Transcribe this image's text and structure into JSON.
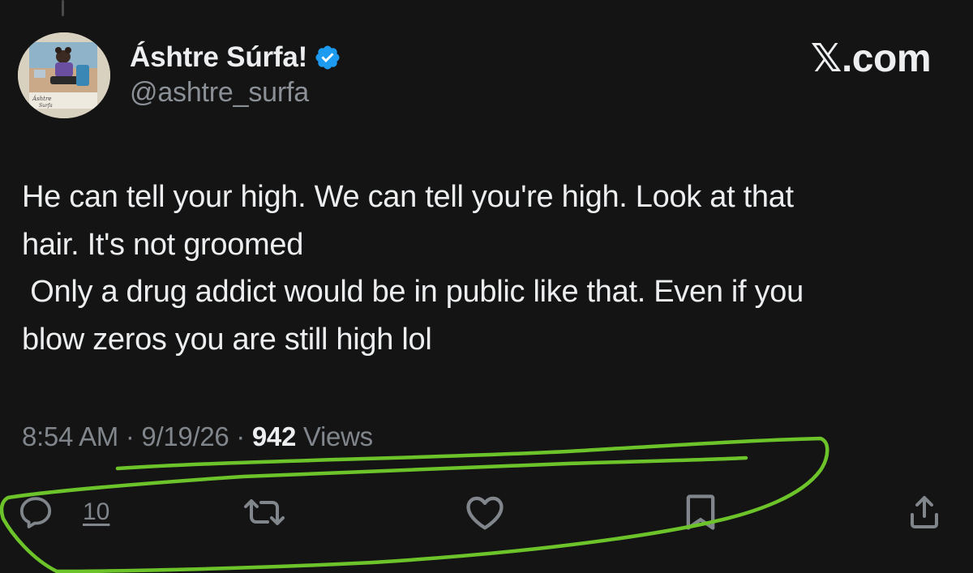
{
  "brand": {
    "label": "𝕏.com"
  },
  "author": {
    "display_name": "Áshtre Súrfa!",
    "handle": "@ashtre_surfa",
    "verified": true
  },
  "avatar": {
    "caption_line1": "Áshtre",
    "caption_line2": "Surfa"
  },
  "tweet": {
    "text": "He can tell your high. We can tell you're high. Look at that\nhair. It's not groomed\n Only a drug addict would be in public like that. Even if you\nblow zeros you are still high lol"
  },
  "meta": {
    "time": "8:54 AM",
    "sep1": " · ",
    "date": "9/19/26",
    "sep2": " · ",
    "views_count": "942",
    "views_label": " Views"
  },
  "actions": {
    "reply_count": "10",
    "icons": [
      "reply-icon",
      "retweet-icon",
      "like-icon",
      "bookmark-icon",
      "share-icon"
    ]
  },
  "colors": {
    "background": "#141414",
    "text": "#eceef0",
    "muted": "#80868c",
    "verified": "#1d9bf0",
    "annotation": "#6cc42a"
  }
}
